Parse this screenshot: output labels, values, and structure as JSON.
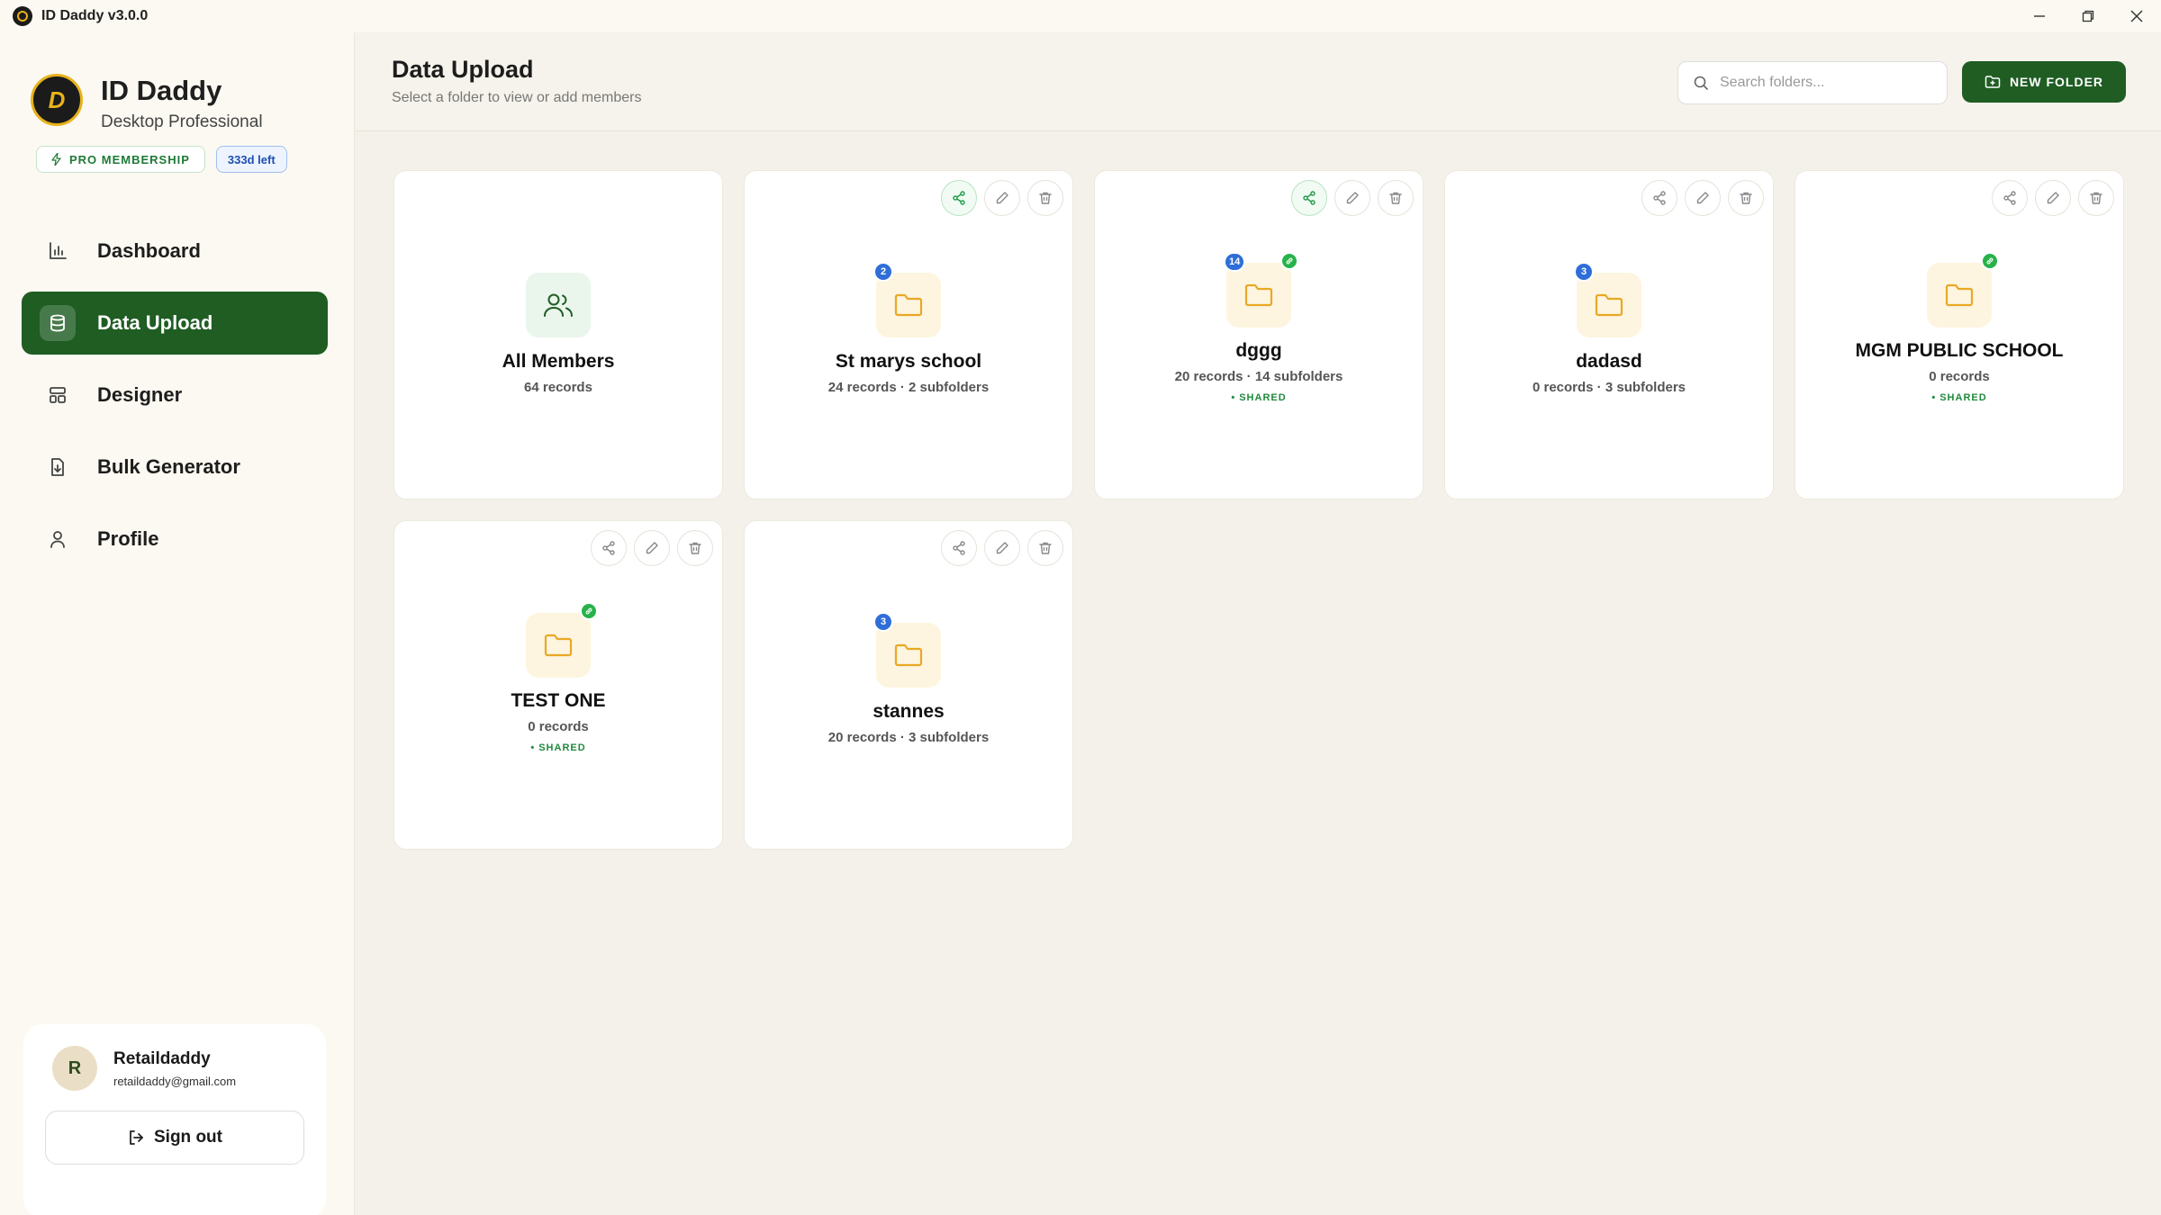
{
  "window": {
    "title": "ID Daddy v3.0.0"
  },
  "brand": {
    "name": "ID Daddy",
    "subtitle": "Desktop Professional",
    "membership": "PRO MEMBERSHIP",
    "days_left": "333d left"
  },
  "nav": [
    {
      "label": "Dashboard",
      "icon": "bar-chart-icon",
      "active": false
    },
    {
      "label": "Data Upload",
      "icon": "database-icon",
      "active": true
    },
    {
      "label": "Designer",
      "icon": "layout-icon",
      "active": false
    },
    {
      "label": "Bulk Generator",
      "icon": "file-download-icon",
      "active": false
    },
    {
      "label": "Profile",
      "icon": "user-icon",
      "active": false
    }
  ],
  "user": {
    "initial": "R",
    "name": "Retaildaddy",
    "email": "retaildaddy@gmail.com",
    "signout_label": "Sign out"
  },
  "header": {
    "title": "Data Upload",
    "subtitle": "Select a folder to view or add members",
    "search_placeholder": "Search folders...",
    "new_folder_label": "NEW FOLDER"
  },
  "cards": [
    {
      "name": "All Members",
      "meta": "64 records",
      "type": "members"
    },
    {
      "name": "St marys school",
      "meta": "24 records · 2 subfolders",
      "count": "2",
      "shared_active": true
    },
    {
      "name": "dggg",
      "meta": "20 records · 14 subfolders",
      "count": "14",
      "linked": true,
      "shared": "• SHARED",
      "shared_active": true
    },
    {
      "name": "dadasd",
      "meta": "0 records · 3 subfolders",
      "count": "3"
    },
    {
      "name": "MGM PUBLIC SCHOOL",
      "meta": "0 records",
      "linked": true,
      "shared": "• SHARED"
    },
    {
      "name": "TEST ONE",
      "meta": "0 records",
      "linked": true,
      "shared": "• SHARED"
    },
    {
      "name": "stannes",
      "meta": "20 records · 3 subfolders",
      "count": "3"
    }
  ],
  "colors": {
    "primary": "#1f5d23",
    "folder_bg": "#fdf5df",
    "folder_icon": "#e9a825",
    "count_badge": "#2f6ed8",
    "link_badge": "#27b24a"
  }
}
